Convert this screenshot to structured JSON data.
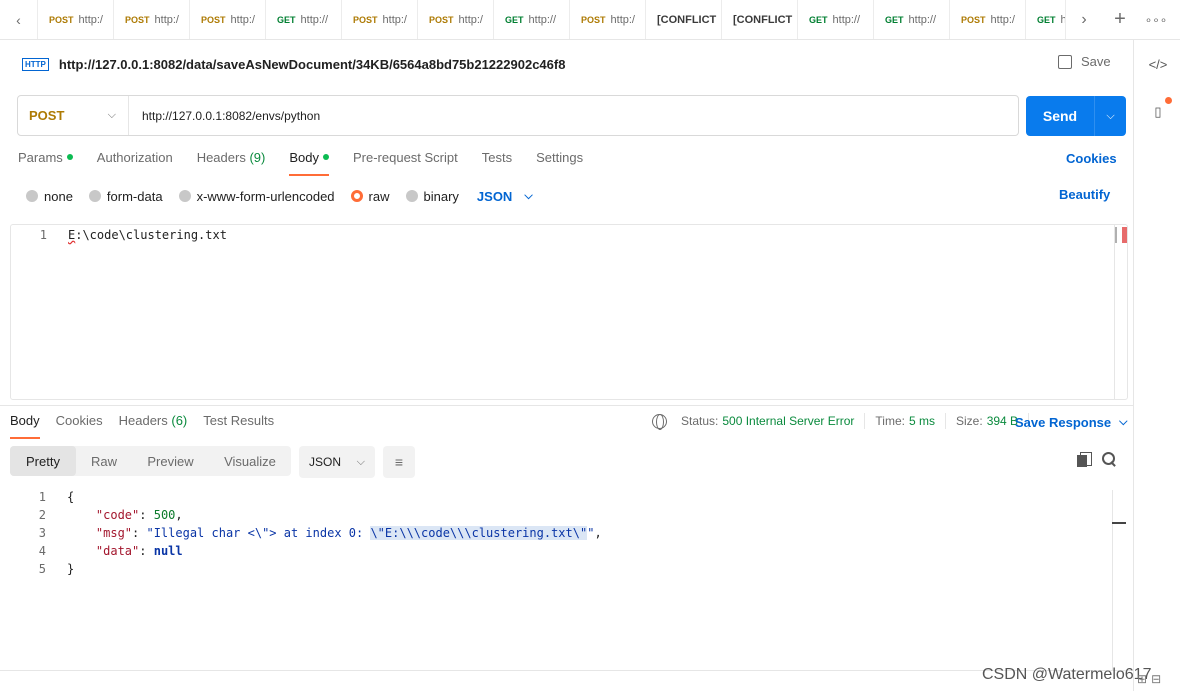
{
  "tabs": [
    {
      "method": "POST",
      "label": "http:/"
    },
    {
      "method": "POST",
      "label": "http:/"
    },
    {
      "method": "POST",
      "label": "http:/"
    },
    {
      "method": "GET",
      "label": "http://"
    },
    {
      "method": "POST",
      "label": "http:/"
    },
    {
      "method": "POST",
      "label": "http:/"
    },
    {
      "method": "GET",
      "label": "http://"
    },
    {
      "method": "POST",
      "label": "http:/"
    },
    {
      "method": "",
      "label": "[CONFLICT"
    },
    {
      "method": "",
      "label": "[CONFLICT"
    },
    {
      "method": "GET",
      "label": "http://"
    },
    {
      "method": "GET",
      "label": "http://"
    },
    {
      "method": "POST",
      "label": "http:/"
    },
    {
      "method": "GET",
      "label": "h"
    }
  ],
  "request": {
    "icon_text": "HTTP",
    "title": "http://127.0.0.1:8082/data/saveAsNewDocument/34KB/6564a8bd75b21222902c46f8",
    "save_label": "Save",
    "method": "POST",
    "url": "http://127.0.0.1:8082/envs/python",
    "send_label": "Send"
  },
  "req_tabs": {
    "params": "Params",
    "authorization": "Authorization",
    "headers": "Headers",
    "headers_count": "(9)",
    "body": "Body",
    "prerequest": "Pre-request Script",
    "tests": "Tests",
    "settings": "Settings",
    "cookies": "Cookies"
  },
  "body_types": {
    "none": "none",
    "form_data": "form-data",
    "urlencoded": "x-www-form-urlencoded",
    "raw": "raw",
    "binary": "binary",
    "format": "JSON",
    "beautify": "Beautify"
  },
  "editor": {
    "line_number": "1",
    "first_char": "E",
    "rest": ":\\code\\clustering.txt"
  },
  "response": {
    "tabs": {
      "body": "Body",
      "cookies": "Cookies",
      "headers": "Headers",
      "headers_count": "(6)",
      "test_results": "Test Results"
    },
    "status_label": "Status:",
    "status_value": "500 Internal Server Error",
    "time_label": "Time:",
    "time_value": "5 ms",
    "size_label": "Size:",
    "size_value": "394 B",
    "save_response": "Save Response",
    "views": {
      "pretty": "Pretty",
      "raw": "Raw",
      "preview": "Preview",
      "visualize": "Visualize"
    },
    "format": "JSON",
    "lines": {
      "l1": "{",
      "code_key": "\"code\"",
      "code_val": "500",
      "msg_key": "\"msg\"",
      "msg_val_a": "\"Illegal char <\\\"> at index 0: ",
      "msg_val_b": "\\\"E:\\\\\\code\\\\\\clustering.txt\\\"",
      "msg_val_c": "\"",
      "data_key": "\"data\"",
      "data_val": "null",
      "l5": "}"
    }
  },
  "watermark": "CSDN @Watermelo617"
}
